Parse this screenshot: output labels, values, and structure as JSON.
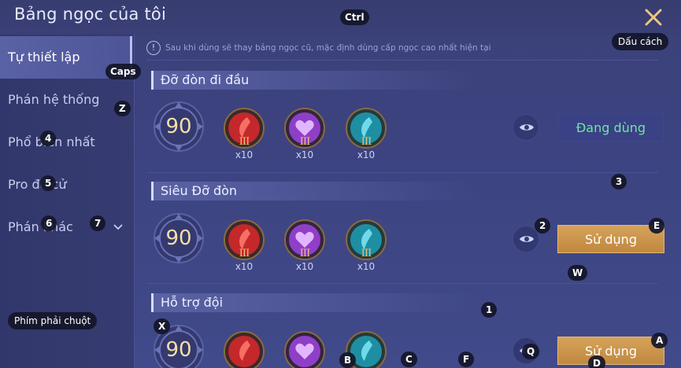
{
  "header": {
    "title": "Bảng ngọc của tôi"
  },
  "notice": {
    "icon": "!",
    "text": "Sau khi dùng sẽ thay bảng ngọc cũ, mặc định dùng cấp ngọc cao nhất hiện tại"
  },
  "sidebar": {
    "items": [
      {
        "label": "Tự thiết lập",
        "active": true
      },
      {
        "label": "Phán hệ thống"
      },
      {
        "label": "Phổ biến nhất"
      },
      {
        "label": "Pro đề cử"
      },
      {
        "label": "Phán khác",
        "chevron": "chevron-down-icon"
      }
    ]
  },
  "sets": [
    {
      "name": "Đỡ đòn đi đầu",
      "level": "90",
      "runes": [
        {
          "color": "red",
          "tier": "III",
          "qty": "x10"
        },
        {
          "color": "purple",
          "tier": "III",
          "qty": "x10"
        },
        {
          "color": "teal",
          "tier": "III",
          "qty": "x10"
        }
      ],
      "action": "Đang dùng",
      "in_use": true
    },
    {
      "name": "Siêu Đỡ đòn",
      "level": "90",
      "runes": [
        {
          "color": "red",
          "tier": "III",
          "qty": "x10"
        },
        {
          "color": "purple",
          "tier": "III",
          "qty": "x10"
        },
        {
          "color": "teal",
          "tier": "III",
          "qty": "x10"
        }
      ],
      "action": "Sử dụng",
      "in_use": false
    },
    {
      "name": "Hỗ trợ đội",
      "level": "90",
      "runes": [
        {
          "color": "red"
        },
        {
          "color": "purple"
        },
        {
          "color": "teal"
        }
      ],
      "action": "Sử dụng",
      "in_use": false
    }
  ],
  "key_hints": {
    "ctrl": "Ctrl",
    "space": "Dấu cách",
    "caps": "Caps",
    "z": "Z",
    "k4": "4",
    "k5": "5",
    "k6": "6",
    "k7": "7",
    "k3": "3",
    "k2": "2",
    "e": "E",
    "w": "W",
    "k1": "1",
    "right_click": "Phím phải chuột",
    "x": "X",
    "a": "A",
    "q": "Q",
    "b": "B",
    "c": "C",
    "f": "F",
    "d": "D"
  },
  "colors": {
    "background": "#3b4178",
    "use_button": "#d6a259",
    "in_use_text": "#73e2a6",
    "level_text": "#f5dfa6",
    "rune_red": "#c4282b",
    "rune_purple": "#8f3fc7",
    "rune_teal": "#1e8fa3"
  }
}
